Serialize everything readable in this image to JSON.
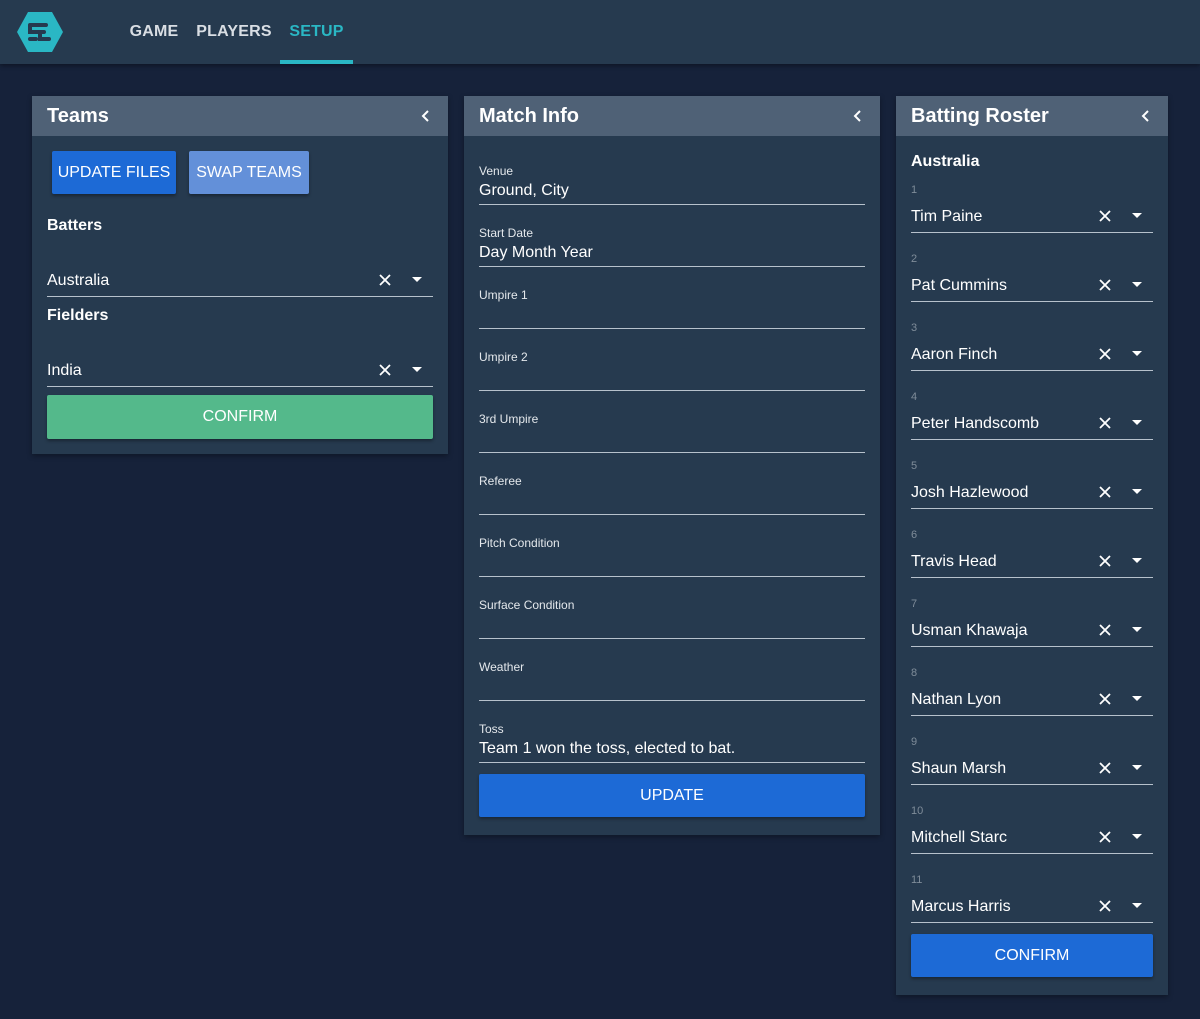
{
  "nav": {
    "tabs": [
      {
        "label": "GAME"
      },
      {
        "label": "PLAYERS"
      },
      {
        "label": "SETUP",
        "active": true
      }
    ],
    "accent_color": "#2ab7c4"
  },
  "teams_panel": {
    "title": "Teams",
    "update_files_label": "UPDATE FILES",
    "swap_teams_label": "SWAP TEAMS",
    "batters_label": "Batters",
    "batters_value": "Australia",
    "fielders_label": "Fielders",
    "fielders_value": "India",
    "confirm_label": "CONFIRM"
  },
  "match_panel": {
    "title": "Match Info",
    "fields": [
      {
        "label": "Venue",
        "value": "Ground, City"
      },
      {
        "label": "Start Date",
        "value": "Day Month Year"
      },
      {
        "label": "Umpire 1",
        "value": ""
      },
      {
        "label": "Umpire 2",
        "value": ""
      },
      {
        "label": "3rd Umpire",
        "value": ""
      },
      {
        "label": "Referee",
        "value": ""
      },
      {
        "label": "Pitch Condition",
        "value": ""
      },
      {
        "label": "Surface Condition",
        "value": ""
      },
      {
        "label": "Weather",
        "value": ""
      },
      {
        "label": "Toss",
        "value": "Team 1 won the toss, elected to bat."
      }
    ],
    "update_label": "UPDATE"
  },
  "roster_panel": {
    "title": "Batting Roster",
    "team_name": "Australia",
    "players": [
      {
        "num": "1",
        "name": "Tim Paine"
      },
      {
        "num": "2",
        "name": "Pat Cummins"
      },
      {
        "num": "3",
        "name": "Aaron Finch"
      },
      {
        "num": "4",
        "name": "Peter Handscomb"
      },
      {
        "num": "5",
        "name": "Josh Hazlewood"
      },
      {
        "num": "6",
        "name": "Travis Head"
      },
      {
        "num": "7",
        "name": "Usman Khawaja"
      },
      {
        "num": "8",
        "name": "Nathan Lyon"
      },
      {
        "num": "9",
        "name": "Shaun Marsh"
      },
      {
        "num": "10",
        "name": "Mitchell Starc"
      },
      {
        "num": "11",
        "name": "Marcus Harris"
      }
    ],
    "confirm_label": "CONFIRM"
  },
  "icons": {
    "logo": "hexagon-logo-icon",
    "collapse": "chevron-left-icon",
    "clear": "close-icon",
    "dropdown": "caret-down-icon"
  },
  "colors": {
    "background": "#16223a",
    "panel": "#263a4f",
    "panel_header": "#4f6176",
    "primary_button": "#1d6ad6",
    "secondary_button": "#6390d9",
    "confirm_button": "#54b98b"
  }
}
